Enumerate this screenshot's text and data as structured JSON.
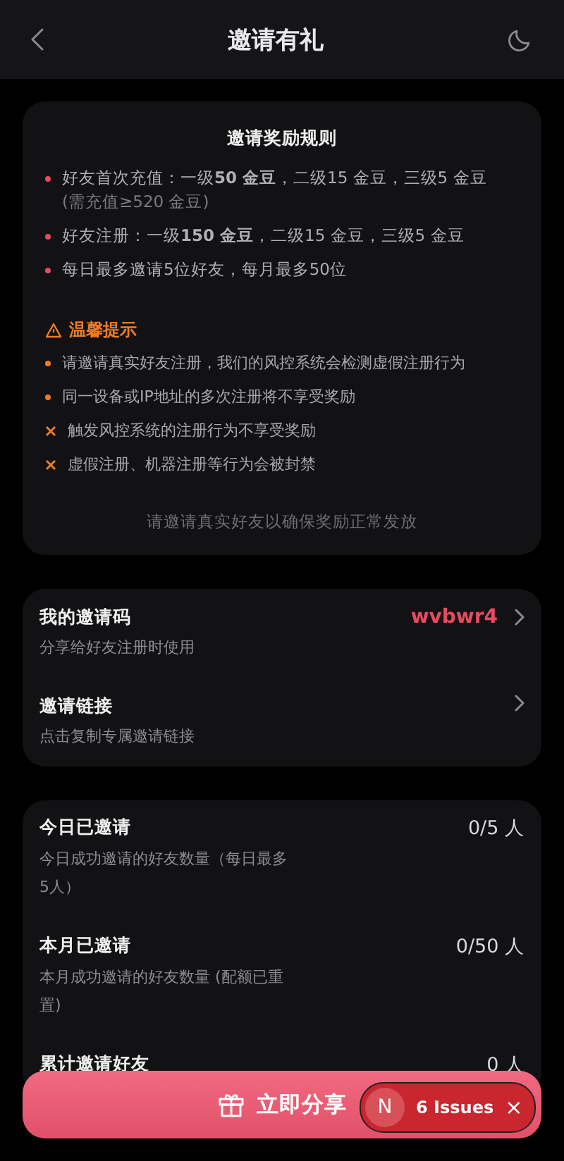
{
  "header": {
    "title": "邀请有礼"
  },
  "rules": {
    "title": "邀请奖励规则",
    "items": [
      {
        "text": "好友首次充值：一级**50 金豆**，二级15 金豆，三级5 金豆",
        "note": "(需充值≥520 金豆)"
      },
      {
        "text": "好友注册：一级**150 金豆**，二级15 金豆，三级5 金豆"
      },
      {
        "text": "每日最多邀请5位好友，每月最多50位"
      }
    ],
    "tips_title": "温馨提示",
    "tips": [
      {
        "kind": "dot",
        "text": "请邀请真实好友注册，我们的风控系统会检测虚假注册行为"
      },
      {
        "kind": "dot",
        "text": "同一设备或IP地址的多次注册将不享受奖励"
      },
      {
        "kind": "cross",
        "text": "触发风控系统的注册行为不享受奖励"
      },
      {
        "kind": "cross",
        "text": "虚假注册、机器注册等行为会被封禁"
      }
    ],
    "footer": "请邀请真实好友以确保奖励正常发放"
  },
  "links": [
    {
      "title": "我的邀请码",
      "subtitle": "分享给好友注册时使用",
      "value": "wvbwr4"
    },
    {
      "title": "邀请链接",
      "subtitle": "点击复制专属邀请链接"
    }
  ],
  "stats": [
    {
      "title": "今日已邀请",
      "subtitle": "今日成功邀请的好友数量（每日最多5人）",
      "value": "0/5 人"
    },
    {
      "title": "本月已邀请",
      "subtitle": "本月成功邀请的好友数量 (配额已重置)",
      "value": "0/50 人"
    },
    {
      "title": "累计邀请好友",
      "value": "0 人"
    }
  ],
  "share_button": {
    "label": "立即分享"
  },
  "dev_badge": {
    "logo": "N",
    "issues": "6 Issues",
    "close": "×"
  }
}
